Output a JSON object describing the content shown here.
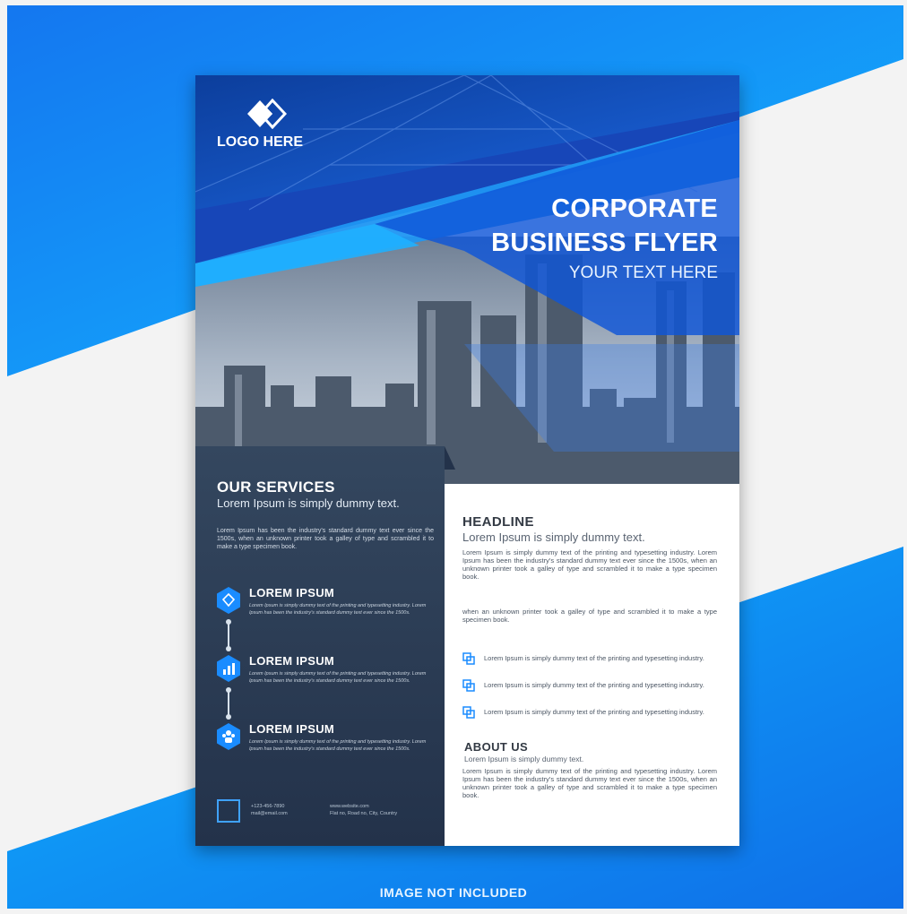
{
  "flyer": {
    "logo_text": "LOGO HERE",
    "title_line1": "CORPORATE",
    "title_line2": "BUSINESS FLYER",
    "tagline": "YOUR TEXT HERE",
    "services": {
      "title": "OUR SERVICES",
      "subtitle": "Lorem Ipsum is simply dummy text.",
      "paragraph": "Lorem Ipsum has been the industry's standard dummy text ever since the 1500s, when an unknown printer took a galley of type and scrambled it to make a type specimen book.",
      "items": [
        {
          "title": "LOREM IPSUM",
          "text": "Lorem Ipsum is simply dummy text of the printing and typesetting industry. Lorem Ipsum has been the industry's standard dummy text ever since the 1500s.",
          "icon": "diamond-icon"
        },
        {
          "title": "LOREM IPSUM",
          "text": "Lorem Ipsum is simply dummy text of the printing and typesetting industry. Lorem Ipsum has been the industry's standard dummy text ever since the 1500s.",
          "icon": "chart-icon"
        },
        {
          "title": "LOREM IPSUM",
          "text": "Lorem Ipsum is simply dummy text of the printing and typesetting industry. Lorem Ipsum has been the industry's standard dummy text ever since the 1500s.",
          "icon": "team-icon"
        }
      ]
    },
    "contact": {
      "phone": "+123-456-7890",
      "email": "mail@email.com",
      "website": "www.website.com",
      "address": "Flat no, Road no, City, Country"
    },
    "headline": {
      "title": "HEADLINE",
      "subtitle": "Lorem Ipsum is simply dummy text.",
      "paragraph1": "Lorem Ipsum is simply dummy text of the printing and typesetting industry. Lorem Ipsum has been the industry's standard dummy text ever since the 1500s, when an unknown printer took a galley of type and scrambled it to make a type specimen book.",
      "paragraph2": "when an unknown printer took a galley of type and scrambled it to make a type specimen book.",
      "bullets": [
        "Lorem Ipsum is simply dummy text of the printing and typesetting industry.",
        "Lorem Ipsum is simply dummy text of the printing and typesetting industry.",
        "Lorem Ipsum is simply dummy text of the printing and typesetting industry."
      ]
    },
    "about": {
      "title": "ABOUT US",
      "subtitle": "Lorem Ipsum is simply dummy text.",
      "paragraph": "Lorem Ipsum is simply dummy text of the printing and typesetting industry. Lorem Ipsum has been the industry's standard dummy text ever since the 1500s, when an unknown printer took a galley of type and scrambled it to make a type specimen book."
    }
  },
  "footer_note": "IMAGE NOT INCLUDED",
  "colors": {
    "accent_blue": "#1a7bf0",
    "light_blue": "#1fb0ff",
    "navy_panel": "#2e3f55",
    "background_gray": "#f2f2f2"
  }
}
